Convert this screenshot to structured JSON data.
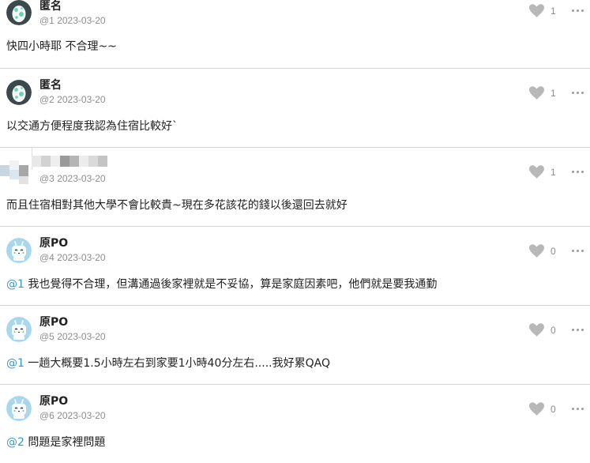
{
  "comments": [
    {
      "name": "匿名",
      "floor": "@1",
      "date": "2023-03-20",
      "mention": "",
      "text": "快四小時耶 不合理~~",
      "likes": "1",
      "avatar": "egg"
    },
    {
      "name": "匿名",
      "floor": "@2",
      "date": "2023-03-20",
      "mention": "",
      "text": "以交通方便程度我認為住宿比較好`",
      "likes": "1",
      "avatar": "egg"
    },
    {
      "name": "",
      "floor": "@3",
      "date": "2023-03-20",
      "mention": "",
      "text": "而且住宿相對其他大學不會比較貴~現在多花該花的錢以後還回去就好",
      "likes": "1",
      "avatar": "blurred"
    },
    {
      "name": "原PO",
      "floor": "@4",
      "date": "2023-03-20",
      "mention": "@1",
      "text": " 我也覺得不合理，但溝通過後家裡就是不妥協，算是家庭因素吧，他們就是要我通勤",
      "likes": "0",
      "avatar": "robot"
    },
    {
      "name": "原PO",
      "floor": "@5",
      "date": "2023-03-20",
      "mention": "@1",
      "text": " 一趟大概要1.5小時左右到家要1小時40分左右.....我好累QAQ",
      "likes": "0",
      "avatar": "robot"
    },
    {
      "name": "原PO",
      "floor": "@6",
      "date": "2023-03-20",
      "mention": "@2",
      "text": " 問題是家裡問題",
      "likes": "0",
      "avatar": "robot"
    }
  ],
  "icons": {
    "like": "heart-icon",
    "more": "more-options-icon"
  },
  "colors": {
    "mention": "#3397cf",
    "meta": "#8e8e8e",
    "divider": "#d6d6d6",
    "heart": "#b8b8b8"
  }
}
